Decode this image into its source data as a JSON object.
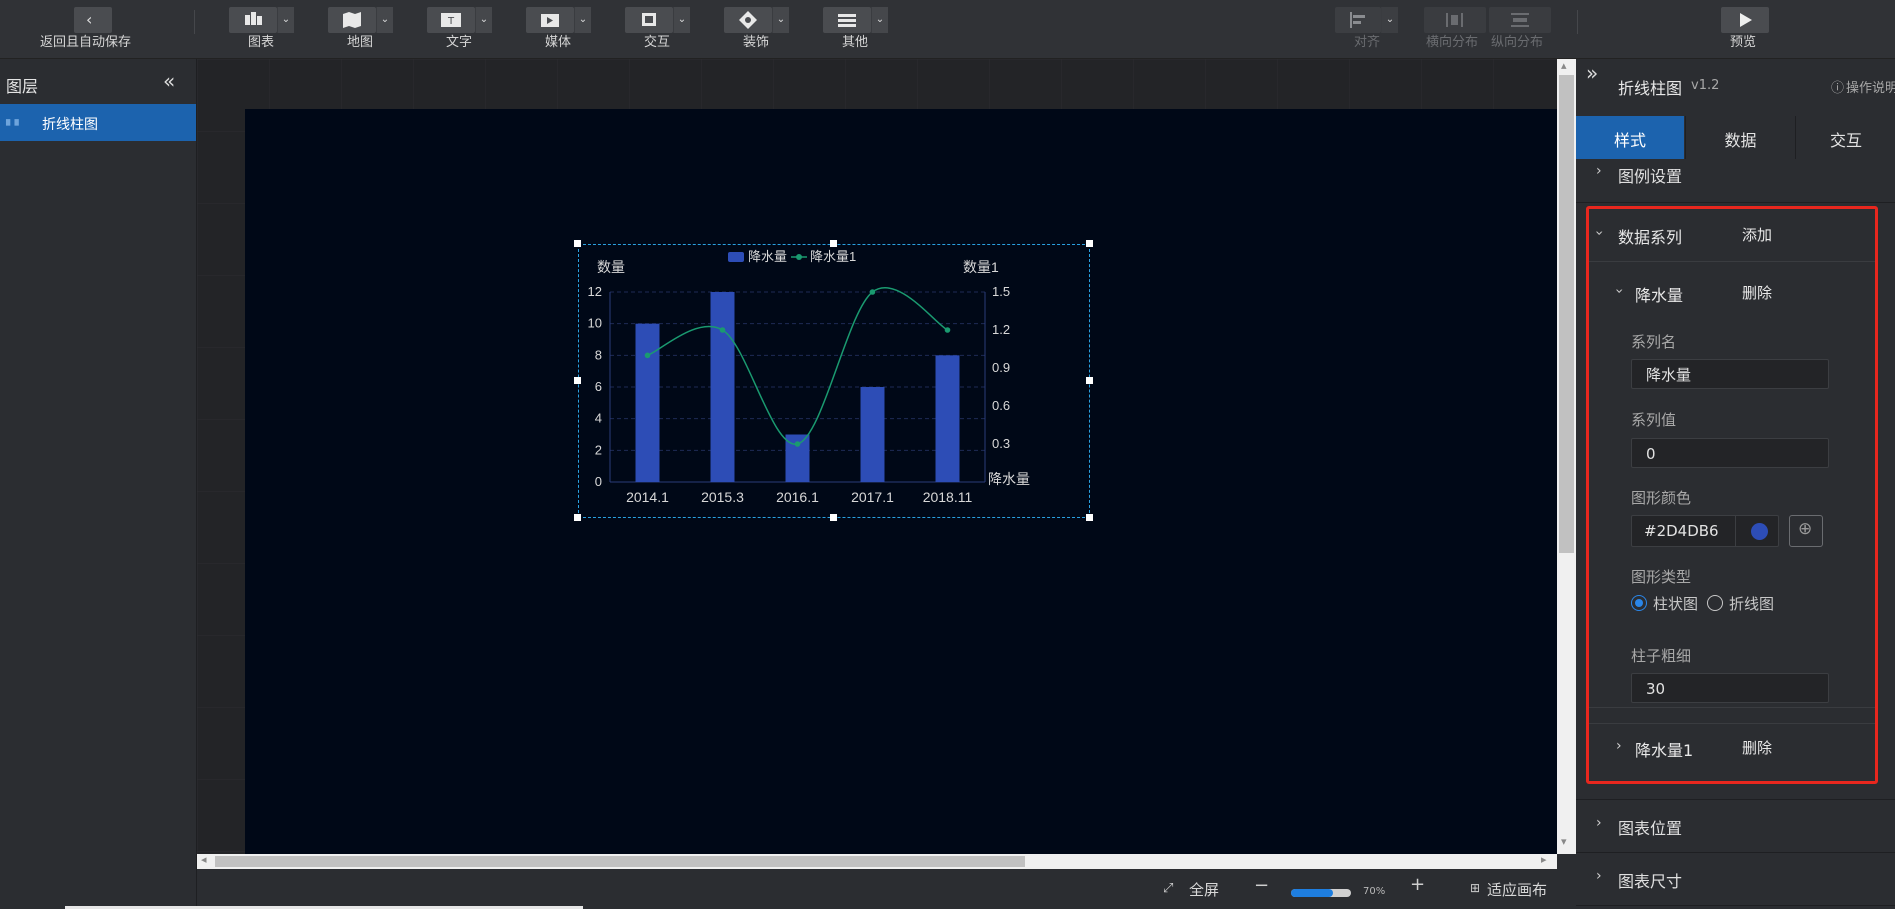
{
  "toolbar": {
    "back_label": "返回且自动保存",
    "groups": [
      {
        "label": "图表",
        "icon": "chart-icon"
      },
      {
        "label": "地图",
        "icon": "map-icon"
      },
      {
        "label": "文字",
        "icon": "text-icon"
      },
      {
        "label": "媒体",
        "icon": "media-icon"
      },
      {
        "label": "交互",
        "icon": "interaction-icon"
      },
      {
        "label": "装饰",
        "icon": "decoration-icon"
      },
      {
        "label": "其他",
        "icon": "other-icon"
      }
    ],
    "align_label": "对齐",
    "h_distribute_label": "横向分布",
    "v_distribute_label": "纵向分布",
    "preview_label": "预览"
  },
  "layers": {
    "title": "图层",
    "items": [
      {
        "label": "折线柱图",
        "selected": true
      }
    ]
  },
  "chart_data": {
    "type": "bar",
    "categories": [
      "2014.1",
      "2015.3",
      "2016.1",
      "2017.1",
      "2018.11"
    ],
    "series": [
      {
        "name": "降水量",
        "type": "bar",
        "values": [
          10,
          12,
          3,
          6,
          8
        ],
        "color": "#2D4DB6"
      },
      {
        "name": "降水量1",
        "type": "line",
        "values": [
          1.0,
          1.2,
          0.3,
          1.5,
          1.2
        ],
        "color": "#1a9a70"
      }
    ],
    "ylabel_left": "数量",
    "ylabel_right": "数量1",
    "xlabel": "降水量",
    "ylim_left": [
      0,
      12
    ],
    "ylim_right": [
      0,
      1.5
    ],
    "yticks_left": [
      "0",
      "2",
      "4",
      "6",
      "8",
      "10",
      "12"
    ],
    "yticks_right": [
      "0.3",
      "0.6",
      "0.9",
      "1.2",
      "1.5"
    ],
    "grid": true,
    "legend_position": "top"
  },
  "rpanel": {
    "title": "折线柱图",
    "version": "v1.2",
    "help": "操作说明",
    "tabs": [
      "样式",
      "数据",
      "交互"
    ],
    "legend_settings": "图例设置",
    "data_series": "数据系列",
    "add": "添加",
    "series1": {
      "name": "降水量",
      "delete": "删除",
      "name_label": "系列名",
      "name_value": "降水量",
      "value_label": "系列值",
      "value_value": "0",
      "color_label": "图形颜色",
      "color_value": "#2D4DB6",
      "type_label": "图形类型",
      "type_bar": "柱状图",
      "type_line": "折线图",
      "width_label": "柱子粗细",
      "width_value": "30"
    },
    "series2": {
      "name": "降水量1",
      "delete": "删除"
    },
    "chart_position": "图表位置",
    "chart_size": "图表尺寸"
  },
  "bottombar": {
    "fullscreen": "全屏",
    "zoom_percent": "70%",
    "zoom_value": 0.7,
    "fit": "适应画布"
  },
  "colors": {
    "accent": "#1f6bb5",
    "series_bar": "#2D4DB6",
    "series_line": "#1a9a70",
    "highlight_box": "#e8271e"
  }
}
